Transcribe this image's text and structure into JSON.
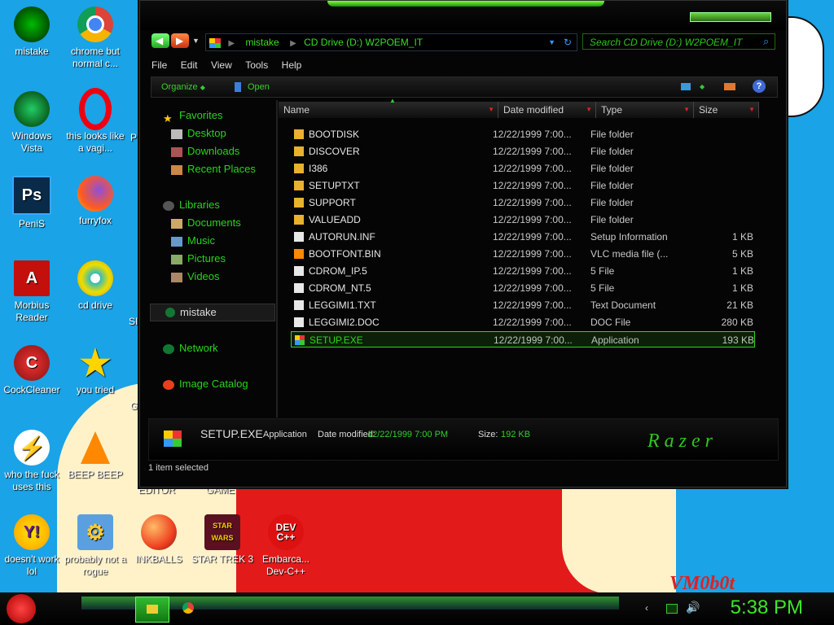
{
  "desktop": {
    "icons": [
      {
        "label": "mistake"
      },
      {
        "label": "chrome but normal c..."
      },
      {
        "label": "Windows Vista"
      },
      {
        "label": "this looks like a vagi..."
      },
      {
        "label": "PeniS"
      },
      {
        "label": "furryfox"
      },
      {
        "label": "Morbius Reader"
      },
      {
        "label": "cd drive"
      },
      {
        "label": "CockCleaner"
      },
      {
        "label": "you tried"
      },
      {
        "label": "who the fuck uses this"
      },
      {
        "label": "BEEP BEEP"
      },
      {
        "label": "doesn't work lol"
      },
      {
        "label": "probably not a rogue"
      },
      {
        "label": "INKBALLS"
      },
      {
        "label": "STAR TREK 3"
      },
      {
        "label": "Embarca... Dev-C++"
      }
    ],
    "partial_labels": {
      "left_edge_1": "EDITOR",
      "left_edge_2": "GAME",
      "p": "P",
      "si": "SI",
      "g": "G"
    },
    "wallpaper_text": "VM0b0t",
    "wallpaper_letter": "t"
  },
  "window": {
    "address": {
      "segment1": "mistake",
      "segment2": "CD Drive (D:) W2POEM_IT"
    },
    "search_placeholder": "Search CD Drive (D:) W2POEM_IT",
    "menu": [
      "File",
      "Edit",
      "View",
      "Tools",
      "Help"
    ],
    "toolbar": {
      "organize": "Organize",
      "open": "Open"
    },
    "nav": {
      "favorites": "Favorites",
      "desktop": "Desktop",
      "downloads": "Downloads",
      "recent": "Recent Places",
      "libraries": "Libraries",
      "documents": "Documents",
      "music": "Music",
      "pictures": "Pictures",
      "videos": "Videos",
      "mistake": "mistake",
      "network": "Network",
      "image_catalog": "Image Catalog"
    },
    "columns": {
      "name": "Name",
      "date": "Date modified",
      "type": "Type",
      "size": "Size"
    },
    "files": [
      {
        "name": "BOOTDISK",
        "date": "12/22/1999 7:00...",
        "type": "File folder",
        "size": "",
        "kind": "folder"
      },
      {
        "name": "DISCOVER",
        "date": "12/22/1999 7:00...",
        "type": "File folder",
        "size": "",
        "kind": "folder"
      },
      {
        "name": "I386",
        "date": "12/22/1999 7:00...",
        "type": "File folder",
        "size": "",
        "kind": "folder"
      },
      {
        "name": "SETUPTXT",
        "date": "12/22/1999 7:00...",
        "type": "File folder",
        "size": "",
        "kind": "folder"
      },
      {
        "name": "SUPPORT",
        "date": "12/22/1999 7:00...",
        "type": "File folder",
        "size": "",
        "kind": "folder"
      },
      {
        "name": "VALUEADD",
        "date": "12/22/1999 7:00...",
        "type": "File folder",
        "size": "",
        "kind": "folder"
      },
      {
        "name": "AUTORUN.INF",
        "date": "12/22/1999 7:00...",
        "type": "Setup Information",
        "size": "1 KB",
        "kind": "file"
      },
      {
        "name": "BOOTFONT.BIN",
        "date": "12/22/1999 7:00...",
        "type": "VLC media file (...",
        "size": "5 KB",
        "kind": "vlc"
      },
      {
        "name": "CDROM_IP.5",
        "date": "12/22/1999 7:00...",
        "type": "5 File",
        "size": "1 KB",
        "kind": "file"
      },
      {
        "name": "CDROM_NT.5",
        "date": "12/22/1999 7:00...",
        "type": "5 File",
        "size": "1 KB",
        "kind": "file"
      },
      {
        "name": "LEGGIMI1.TXT",
        "date": "12/22/1999 7:00...",
        "type": "Text Document",
        "size": "21 KB",
        "kind": "file"
      },
      {
        "name": "LEGGIMI2.DOC",
        "date": "12/22/1999 7:00...",
        "type": "DOC File",
        "size": "280 KB",
        "kind": "file"
      },
      {
        "name": "SETUP.EXE",
        "date": "12/22/1999 7:00...",
        "type": "Application",
        "size": "193 KB",
        "kind": "exe",
        "selected": true
      }
    ],
    "details": {
      "filename": "SETUP.EXE",
      "type": "Application",
      "date_label": "Date modified:",
      "date_value": "12/22/1999 7:00 PM",
      "size_label": "Size:",
      "size_value": "192 KB",
      "brand": "Razer"
    },
    "status": "1 item selected"
  },
  "taskbar": {
    "clock": "5:38 PM"
  }
}
